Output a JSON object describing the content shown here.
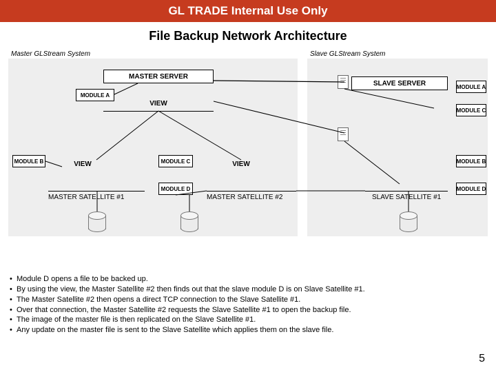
{
  "header": "GL TRADE Internal Use Only",
  "title": "File Backup Network Architecture",
  "captions": {
    "master": "Master GLStream System",
    "slave": "Slave GLStream System"
  },
  "labels": {
    "master_server": "MASTER SERVER",
    "slave_server": "SLAVE SERVER",
    "module_a_left": "MODULE A",
    "module_a_right": "MODULE A",
    "module_b_left": "MODULE B",
    "module_b_right": "MODULE B",
    "module_c_mid": "MODULE C",
    "module_c_right": "MODULE C",
    "module_d_mid": "MODULE D",
    "module_d_right": "MODULE D",
    "view1": "VIEW",
    "view2": "VIEW",
    "view3": "VIEW",
    "master_sat1": "MASTER SATELLITE #1",
    "master_sat2": "MASTER SATELLITE #2",
    "slave_sat1": "SLAVE SATELLITE #1"
  },
  "bullets": [
    "Module D opens a file to be backed up.",
    "By using the view, the Master Satellite #2 then finds out that the slave module D is on Slave Satellite #1.",
    "The Master Satellite #2 then opens a direct TCP connection to the Slave Satellite #1.",
    "Over that connection, the Master Satellite #2 requests the Slave Satellite #1 to open the backup file.",
    "The image of the master file is then replicated on the Slave Satellite #1.",
    "Any update on the master file is sent to the Slave Satellite which applies them on the slave file."
  ],
  "page_number": "5"
}
